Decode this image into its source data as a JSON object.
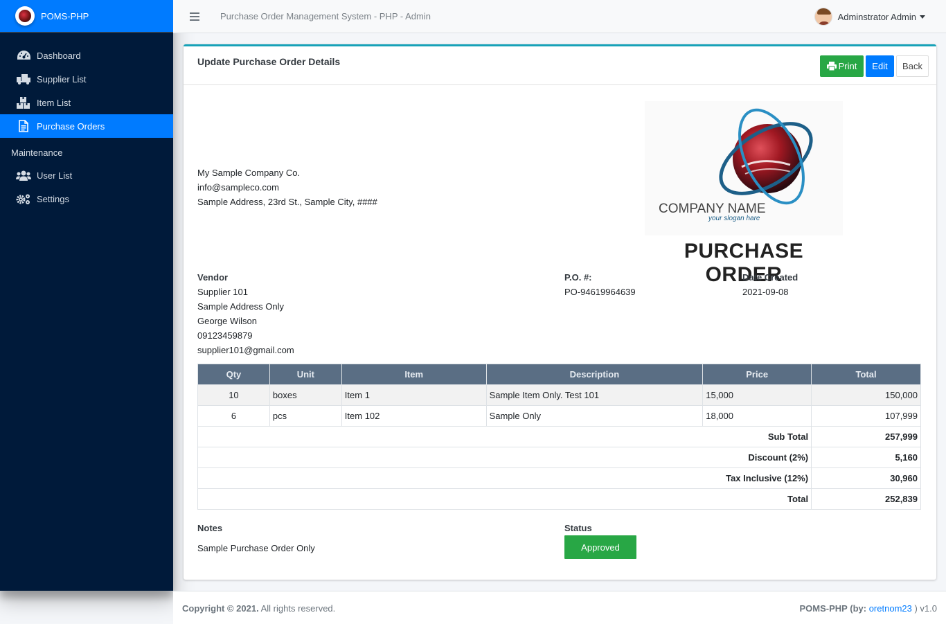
{
  "brand": {
    "name": "POMS-PHP"
  },
  "topbar": {
    "title": "Purchase Order Management System - PHP - Admin",
    "user": "Adminstrator Admin"
  },
  "sidebar": {
    "items": [
      {
        "label": "Dashboard",
        "icon": "dashboard-icon"
      },
      {
        "label": "Supplier List",
        "icon": "truck-icon"
      },
      {
        "label": "Item List",
        "icon": "boxes-icon"
      },
      {
        "label": "Purchase Orders",
        "icon": "file-icon",
        "active": true
      }
    ],
    "section": "Maintenance",
    "maintenance": [
      {
        "label": "User List",
        "icon": "users-icon"
      },
      {
        "label": "Settings",
        "icon": "cogs-icon"
      }
    ]
  },
  "card": {
    "title": "Update Purchase Order Details",
    "buttons": {
      "print": "Print",
      "edit": "Edit",
      "back": "Back"
    }
  },
  "company": {
    "name": "My Sample Company Co.",
    "email": "info@sampleco.com",
    "address": "Sample Address, 23rd St., Sample City, ####"
  },
  "logo": {
    "name": "COMPANY NAME",
    "slogan": "your slogan hare"
  },
  "po_title": "PURCHASE ORDER",
  "vendor": {
    "label": "Vendor",
    "name": "Supplier 101",
    "address": "Sample Address Only",
    "contact": "George Wilson",
    "phone": "09123459879",
    "email": "supplier101@gmail.com"
  },
  "po_number": {
    "label": "P.O. #:",
    "value": "PO-94619964639"
  },
  "date_created": {
    "label": "Date Created",
    "value": "2021-09-08"
  },
  "table": {
    "headers": [
      "Qty",
      "Unit",
      "Item",
      "Description",
      "Price",
      "Total"
    ],
    "rows": [
      [
        "10",
        "boxes",
        "Item 1",
        "Sample Item Only. Test 101",
        "15,000",
        "150,000"
      ],
      [
        "6",
        "pcs",
        "Item 102",
        "Sample Only",
        "18,000",
        "107,999"
      ]
    ],
    "summary": [
      {
        "label": "Sub Total",
        "value": "257,999"
      },
      {
        "label": "Discount (2%)",
        "value": "5,160"
      },
      {
        "label": "Tax Inclusive (12%)",
        "value": "30,960"
      },
      {
        "label": "Total",
        "value": "252,839"
      }
    ]
  },
  "notes": {
    "label": "Notes",
    "value": "Sample Purchase Order Only"
  },
  "status": {
    "label": "Status",
    "value": "Approved",
    "color": "#28a745"
  },
  "footer": {
    "copyright": "Copyright © 2021.",
    "rights": "All rights reserved.",
    "app": "POMS-PHP (by:",
    "author": "oretnom23",
    "version": ") v1.0"
  }
}
